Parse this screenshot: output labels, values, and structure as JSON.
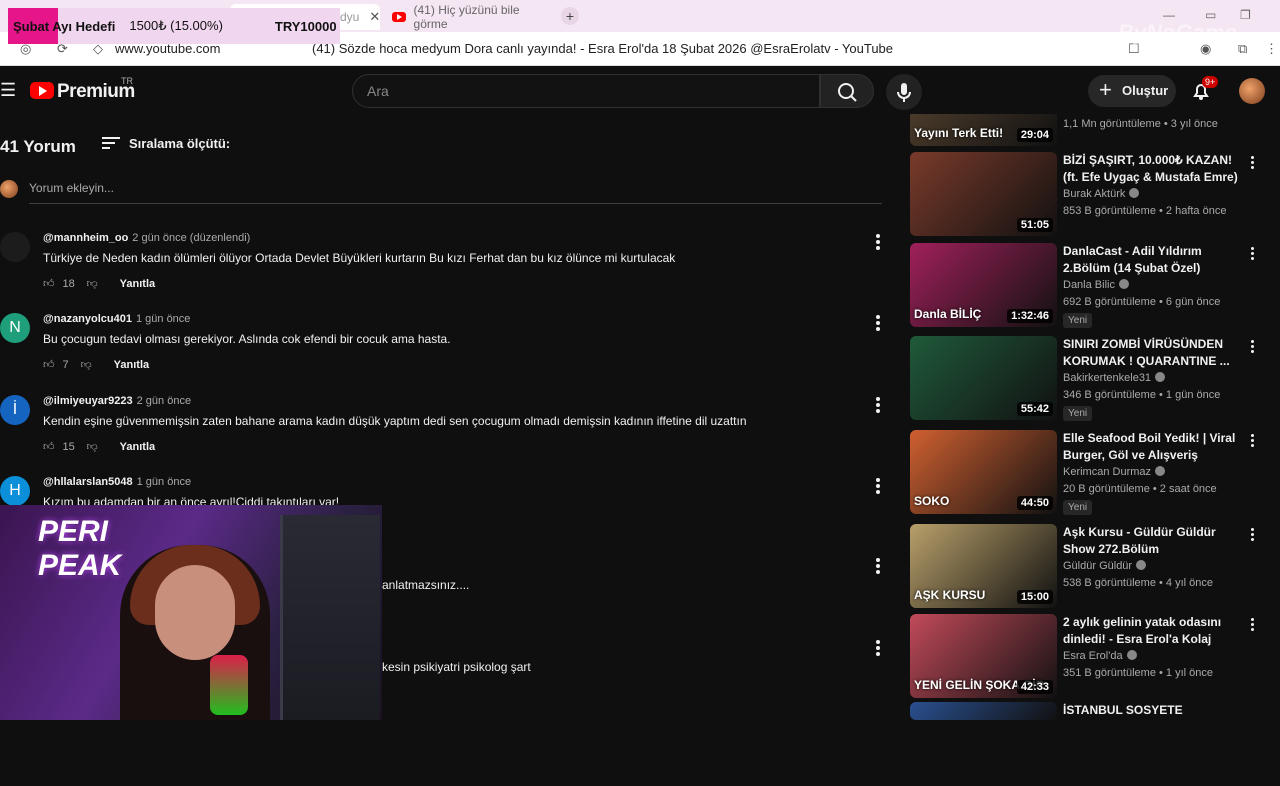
{
  "browser": {
    "tabs": [
      {
        "label": "dyu"
      },
      {
        "label": "(41) Hiç yüzünü bile görme"
      }
    ],
    "url": "www.youtube.com",
    "page_title": "(41) Sözde hoca medyum Dora canlı yayında! - Esra Erol'da 18 Şubat 2026 @EsraErolatv - YouTube"
  },
  "overlay": {
    "goal_label": "Şubat Ayı Hedefi",
    "goal_progress": "1500₺ (15.00%)",
    "goal_target": "TRY10000",
    "goal_fraction": 0.15,
    "watermark": "ByNoGame",
    "cam_logo": "PERI PEAK"
  },
  "header": {
    "logo": "Premium",
    "region": "TR",
    "search_placeholder": "Ara",
    "create_label": "Oluştur",
    "notif_count": "9+"
  },
  "comments_section": {
    "count_label": "41 Yorum",
    "sort_label": "Sıralama ölçütü:",
    "add_placeholder": "Yorum ekleyin...",
    "reply_label": "Yanıtla",
    "items": [
      {
        "avatar": "",
        "avatar_color": "#1c1c1c",
        "author": "@mannheim_oo",
        "time": "2 gün önce (düzenlendi)",
        "text": "Türkiye de Neden kadın ölümleri ölüyor Ortada Devlet Büyükleri kurtarın Bu kızı  Ferhat dan bu kız ölünce mi kurtulacak",
        "likes": "18"
      },
      {
        "avatar": "N",
        "avatar_color": "#1e9e7a",
        "author": "@nazanyolcu401",
        "time": "1 gün önce",
        "text": "Bu çocugun tedavi olması gerekiyor. Aslında cok efendi bir cocuk ama hasta.",
        "likes": "7"
      },
      {
        "avatar": "İ",
        "avatar_color": "#1565c0",
        "author": "@ilmiyeuyar9223",
        "time": "2 gün önce",
        "text": "Kendin eşine güvenmemişsin zaten bahane arama kadın düşük yaptım dedi sen çocugum olmadı demişsin kadının iffetine dil uzattın",
        "likes": "15"
      },
      {
        "avatar": "H",
        "avatar_color": "#0a8fd8",
        "author": "@hllalarslan5048",
        "time": "1 gün önce",
        "text": "Kızım bu adamdan bir an önce ayrıl!Ciddi takıntıları var!",
        "likes": ""
      }
    ],
    "partial_texts": [
      "anlatmazsınız....",
      "kesin psikiyatri psikolog  şart"
    ]
  },
  "sidebar": {
    "videos": [
      {
        "title": "",
        "thumb_caption": "Yayını Terk Etti!",
        "channel": "",
        "meta": "1,1 Mn görüntüleme • 3 yıl önce",
        "duration": "29:04",
        "new_label": "",
        "color": "#4a3a2a"
      },
      {
        "title": "BİZİ ŞAŞIRT, 10.000₺ KAZAN! (ft. Efe Uygaç & Mustafa Emre)",
        "thumb_caption": "",
        "channel": "Burak Aktürk",
        "meta": "853 B görüntüleme • 2 hafta önce",
        "duration": "51:05",
        "new_label": "",
        "color": "#7a3a2a"
      },
      {
        "title": "DanlaCast - Adil Yıldırım 2.Bölüm (14 Şubat Özel)",
        "thumb_caption": "Danla BİLİÇ",
        "channel": "Danla Bilic",
        "meta": "692 B görüntüleme • 6 gün önce",
        "duration": "1:32:46",
        "new_label": "Yeni",
        "color": "#a0205a"
      },
      {
        "title": "SINIRI ZOMBİ VİRÜSÜNDEN KORUMAK ! QUARANTINE ...",
        "thumb_caption": "",
        "channel": "Bakirkertenkele31",
        "meta": "346 B görüntüleme • 1 gün önce",
        "duration": "55:42",
        "new_label": "Yeni",
        "color": "#1f5a3a"
      },
      {
        "title": "Elle Seafood Boil Yedik! | Viral Burger, Göl ve Alışveriş",
        "thumb_caption": "SOKO",
        "channel": "Kerimcan Durmaz",
        "meta": "20 B görüntüleme • 2 saat önce",
        "duration": "44:50",
        "new_label": "Yeni",
        "color": "#d06030"
      },
      {
        "title": "Aşk Kursu - Güldür Güldür Show 272.Bölüm",
        "thumb_caption": "AŞK KURSU",
        "channel": "Güldür Güldür",
        "meta": "538 B görüntüleme • 4 yıl önce",
        "duration": "15:00",
        "new_label": "",
        "color": "#b9a06a"
      },
      {
        "title": "2 aylık gelinin yatak odasını dinledi! - Esra Erol'a Kolaj",
        "thumb_caption": "YENİ GELİN ŞOKA GİR",
        "channel": "Esra Erol'da",
        "meta": "351 B görüntüleme • 1 yıl önce",
        "duration": "42:33",
        "new_label": "",
        "color": "#c24a5a"
      },
      {
        "title": "İSTANBUL SOSYETE",
        "thumb_caption": "",
        "channel": "",
        "meta": "",
        "duration": "",
        "new_label": "",
        "color": "#2a5090"
      }
    ]
  }
}
